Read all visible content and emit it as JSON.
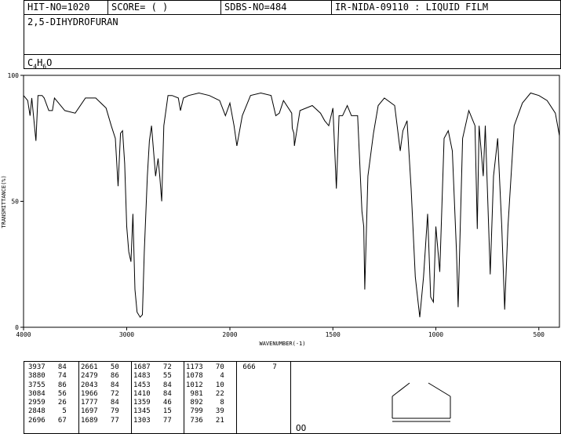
{
  "header": {
    "hit_no": "HIT-NO=1020",
    "score": "SCORE=  (    )",
    "sdbs_no": "SDBS-NO=484",
    "ir_id": "IR-NIDA-09110 : LIQUID FILM"
  },
  "compound": {
    "name": "2,5-DIHYDROFURAN",
    "formula_parts": [
      "C",
      "4",
      "H",
      "6",
      "O"
    ]
  },
  "chart_data": {
    "type": "line",
    "xlabel": "WAVENUMBER(-1)",
    "ylabel": "TRANSMITTANCE(%)",
    "xlim": [
      4000,
      400
    ],
    "ylim": [
      0,
      100
    ],
    "x_ticks": [
      4000,
      3000,
      2000,
      1500,
      1000,
      500
    ],
    "y_ticks": [
      0,
      50,
      100
    ],
    "series": [
      {
        "x": [
          4000,
          3960,
          3937,
          3920,
          3880,
          3860,
          3820,
          3800,
          3755,
          3720,
          3700,
          3600,
          3500,
          3400,
          3300,
          3200,
          3150,
          3110,
          3084,
          3060,
          3040,
          3020,
          3000,
          2980,
          2959,
          2940,
          2920,
          2900,
          2870,
          2848,
          2830,
          2800,
          2780,
          2760,
          2720,
          2696,
          2680,
          2661,
          2640,
          2600,
          2560,
          2500,
          2479,
          2450,
          2400,
          2300,
          2200,
          2100,
          2043,
          2000,
          1980,
          1966,
          1940,
          1900,
          1850,
          1800,
          1777,
          1760,
          1740,
          1700,
          1697,
          1689,
          1687,
          1660,
          1600,
          1560,
          1540,
          1520,
          1500,
          1483,
          1470,
          1453,
          1430,
          1410,
          1380,
          1359,
          1350,
          1345,
          1330,
          1303,
          1280,
          1250,
          1200,
          1173,
          1160,
          1140,
          1120,
          1100,
          1078,
          1060,
          1040,
          1025,
          1012,
          1000,
          981,
          960,
          940,
          920,
          900,
          892,
          870,
          840,
          810,
          799,
          790,
          770,
          760,
          736,
          720,
          700,
          680,
          666,
          650,
          620,
          580,
          540,
          500,
          460,
          420,
          400
        ],
        "y": [
          92,
          90,
          84,
          91,
          74,
          92,
          92,
          91,
          86,
          86,
          91,
          86,
          85,
          91,
          91,
          87,
          80,
          75,
          56,
          77,
          78,
          65,
          40,
          30,
          26,
          45,
          15,
          6,
          4,
          5,
          30,
          60,
          74,
          80,
          60,
          67,
          60,
          50,
          80,
          92,
          92,
          91,
          86,
          91,
          92,
          93,
          92,
          90,
          84,
          89,
          80,
          72,
          84,
          92,
          93,
          92,
          84,
          85,
          90,
          85,
          79,
          77,
          72,
          86,
          88,
          85,
          82,
          80,
          87,
          55,
          84,
          84,
          88,
          84,
          84,
          46,
          40,
          15,
          60,
          77,
          88,
          91,
          88,
          70,
          78,
          82,
          55,
          20,
          4,
          20,
          45,
          12,
          10,
          40,
          22,
          75,
          78,
          70,
          30,
          8,
          75,
          86,
          80,
          39,
          80,
          60,
          80,
          21,
          60,
          75,
          40,
          7,
          40,
          80,
          89,
          93,
          92,
          90,
          85,
          76
        ]
      }
    ]
  },
  "peak_table": {
    "columns": [
      [
        [
          "3937",
          "84"
        ],
        [
          "3880",
          "74"
        ],
        [
          "3755",
          "86"
        ],
        [
          "3084",
          "56"
        ],
        [
          "2959",
          "26"
        ],
        [
          "2848",
          "5"
        ],
        [
          "2696",
          "67"
        ]
      ],
      [
        [
          "2661",
          "50"
        ],
        [
          "2479",
          "86"
        ],
        [
          "2043",
          "84"
        ],
        [
          "1966",
          "72"
        ],
        [
          "1777",
          "84"
        ],
        [
          "1697",
          "79"
        ],
        [
          "1689",
          "77"
        ]
      ],
      [
        [
          "1687",
          "72"
        ],
        [
          "1483",
          "55"
        ],
        [
          "1453",
          "84"
        ],
        [
          "1410",
          "84"
        ],
        [
          "1359",
          "46"
        ],
        [
          "1345",
          "15"
        ],
        [
          "1303",
          "77"
        ]
      ],
      [
        [
          "1173",
          "70"
        ],
        [
          "1078",
          "4"
        ],
        [
          "1012",
          "10"
        ],
        [
          "981",
          "22"
        ],
        [
          "892",
          "8"
        ],
        [
          "799",
          "39"
        ],
        [
          "736",
          "21"
        ]
      ],
      [
        [
          "666",
          "7"
        ]
      ]
    ]
  },
  "footer": {
    "circles": "OO"
  }
}
